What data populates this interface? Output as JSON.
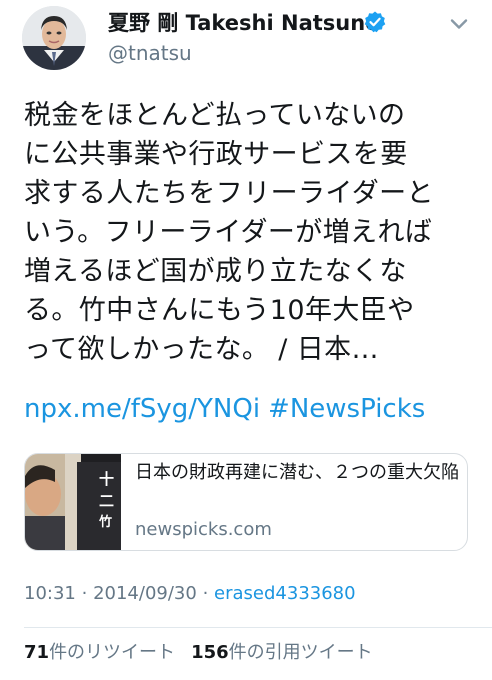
{
  "user": {
    "display_name": "夏野 剛 Takeshi Natsuno",
    "handle": "@tnatsu",
    "verified": true,
    "avatar_icon": "user-avatar"
  },
  "tweet": {
    "lines": [
      "税金をほとんど払っていないの",
      "に公共事業や行政サービスを要",
      "求する人たちをフリーライダーと",
      "いう。フリーライダーが増えれば",
      "増えるほど国が成り立たなくな",
      "る。竹中さんにもう10年大臣や",
      "って欲しかったな。 / 日本…"
    ],
    "link": "npx.me/fSyg/YNQi",
    "hashtag": "#NewsPicks"
  },
  "card": {
    "title": "日本の財政再建に潜む、２つの重大欠陥",
    "domain": "newspicks.com",
    "thumb_chars": [
      "十",
      "二",
      "竹"
    ]
  },
  "meta": {
    "time": "10:31",
    "date": "2014/09/30",
    "source": "erased4333680",
    "separator": "·"
  },
  "stats": {
    "retweets_count": "71",
    "retweets_label": "件のリツイート",
    "quotes_count": "156",
    "quotes_label": "件の引用ツイート"
  },
  "colors": {
    "link": "#1b95e0",
    "verified": "#1da1f2",
    "secondary_text": "#657786"
  },
  "icons": {
    "verified": "verified-badge-icon",
    "menu": "chevron-down-icon"
  }
}
